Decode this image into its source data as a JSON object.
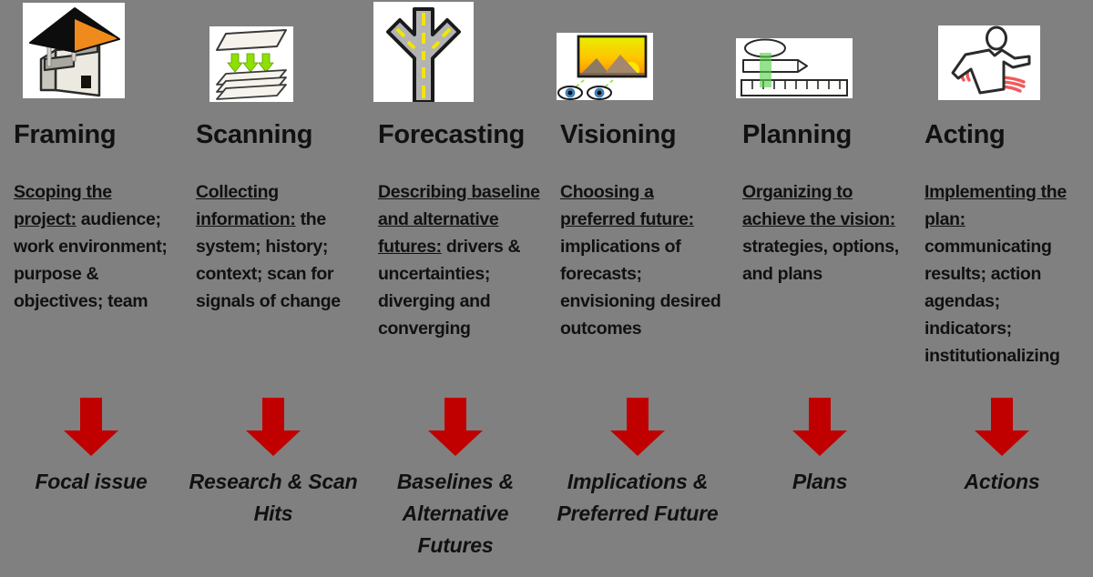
{
  "meta": {
    "background_color": "#808080",
    "arrow_color": "#C00000",
    "text_color": "#111111",
    "icon_panel_color": "#FFFFFF"
  },
  "columns": [
    {
      "id": "framing",
      "icon_name": "house-frame-icon",
      "heading": "Framing",
      "lead": "Scoping the project:",
      "detail": "audience; work environment; purpose & objectives; team",
      "outcome": "Focal issue",
      "arrow_name": "down-arrow-icon"
    },
    {
      "id": "scanning",
      "icon_name": "paper-stack-scan-icon",
      "heading": "Scanning",
      "lead": "Collecting information:",
      "detail": "the system; history; context; scan for signals of change",
      "outcome": "Research & Scan Hits",
      "arrow_name": "down-arrow-icon"
    },
    {
      "id": "forecasting",
      "icon_name": "forking-road-icon",
      "heading": "Forecasting",
      "lead": "Describing baseline and alternative futures:",
      "detail": " drivers & uncertainties; diverging and converging",
      "outcome": "Baselines & Alternative Futures",
      "arrow_name": "down-arrow-icon"
    },
    {
      "id": "visioning",
      "icon_name": "eyes-viewing-landscape-icon",
      "heading": "Visioning",
      "lead": "Choosing a preferred future:",
      "detail": "implications of forecasts; envisioning desired outcomes",
      "outcome": "Implications & Preferred Future",
      "arrow_name": "down-arrow-icon"
    },
    {
      "id": "planning",
      "icon_name": "pencil-ruler-eraser-icon",
      "heading": "Planning",
      "lead": "Organizing to achieve the vision:",
      "detail": "strategies, options, and plans",
      "outcome": "Plans",
      "arrow_name": "down-arrow-icon"
    },
    {
      "id": "acting",
      "icon_name": "running-person-icon",
      "heading": "Acting",
      "lead": "Implementing the plan:",
      "detail": "communicating results; action agendas; indicators; institutionalizing",
      "outcome": "Actions",
      "arrow_name": "down-arrow-icon"
    }
  ]
}
